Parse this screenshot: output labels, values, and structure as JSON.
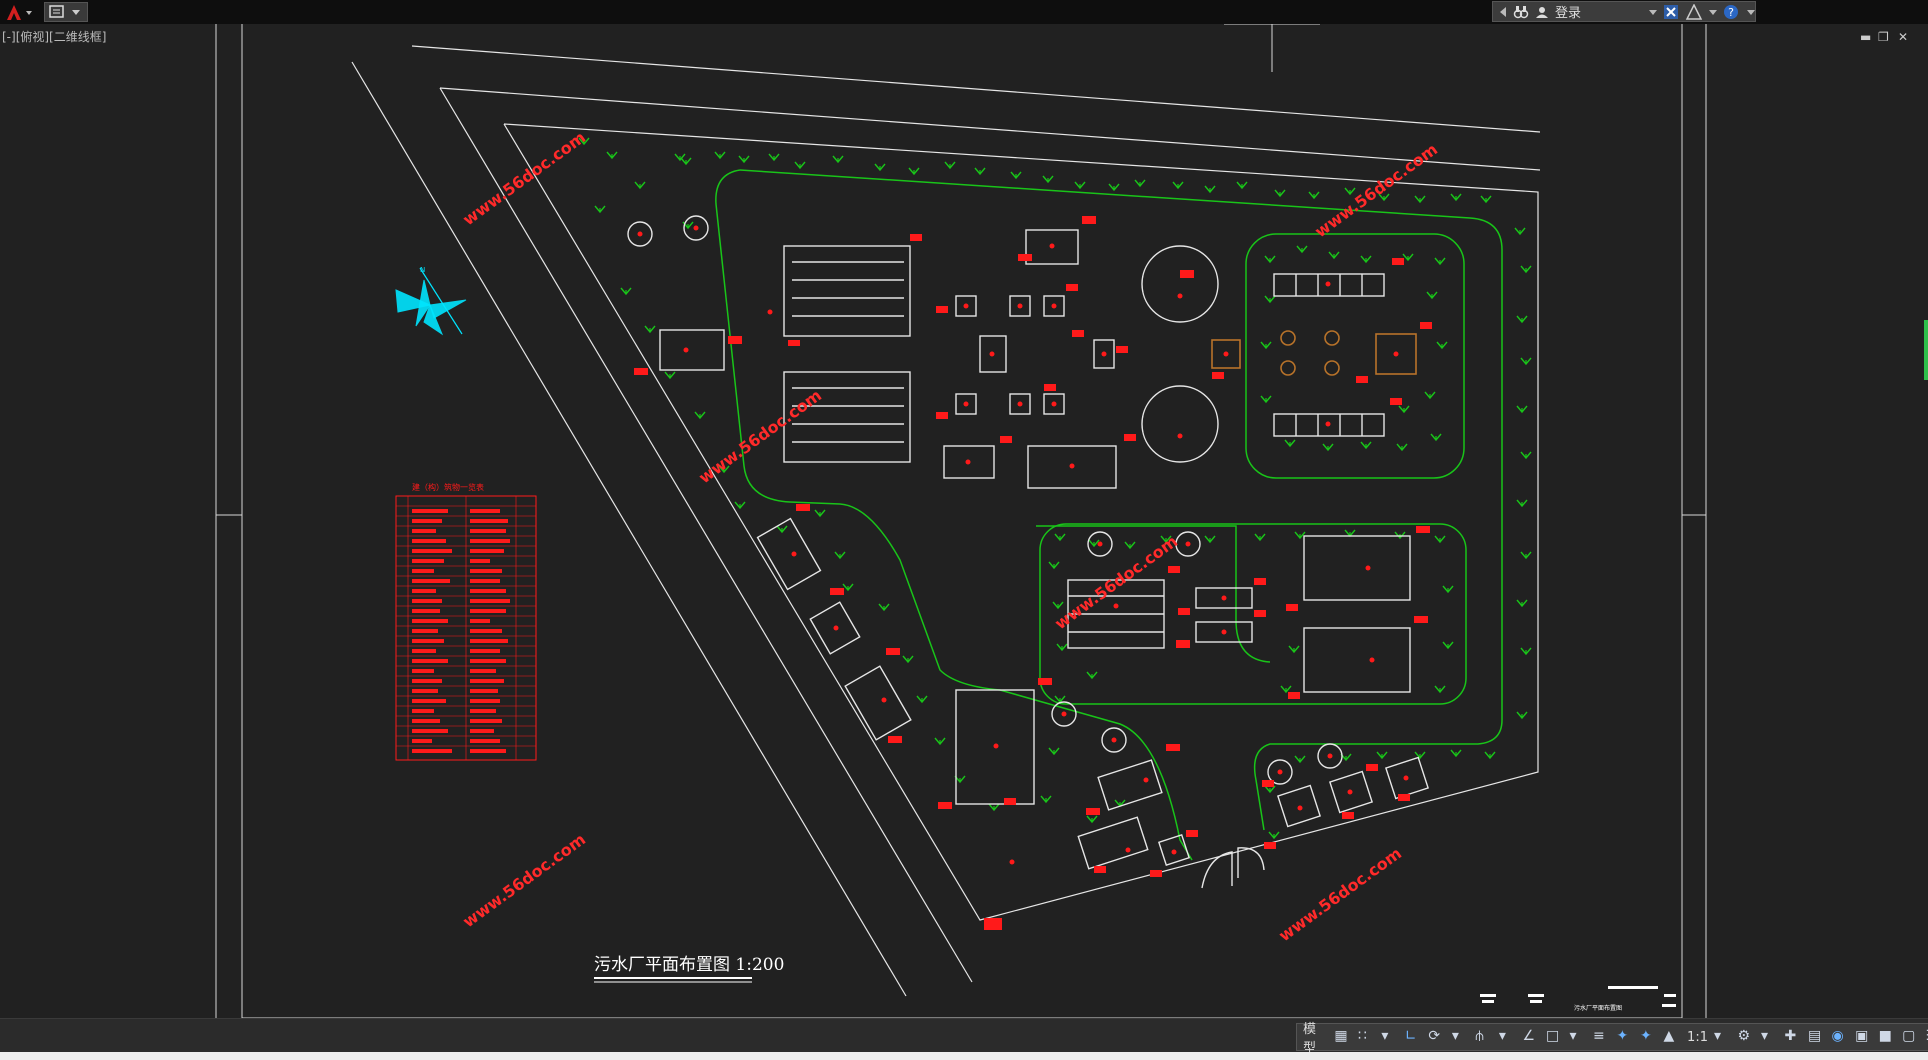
{
  "titlebar": {
    "signin_label": "登录"
  },
  "viewport": {
    "label": "[-][俯视][二维线框]"
  },
  "drawing": {
    "title": "污水厂平面布置图 1:200",
    "title_block_label": "污水厂平面布置图",
    "watermark": "www.56doc.com",
    "table_title": "建（构）筑物一览表"
  },
  "statusbar": {
    "model_label": "模型",
    "scale_label": "1:1"
  },
  "colors": {
    "background": "#212121",
    "linework": "#e6e6e6",
    "greenery": "#19c419",
    "annotation": "#ff1a1a",
    "north_arrow": "#00e5ff",
    "equipment": "#b8732a"
  }
}
